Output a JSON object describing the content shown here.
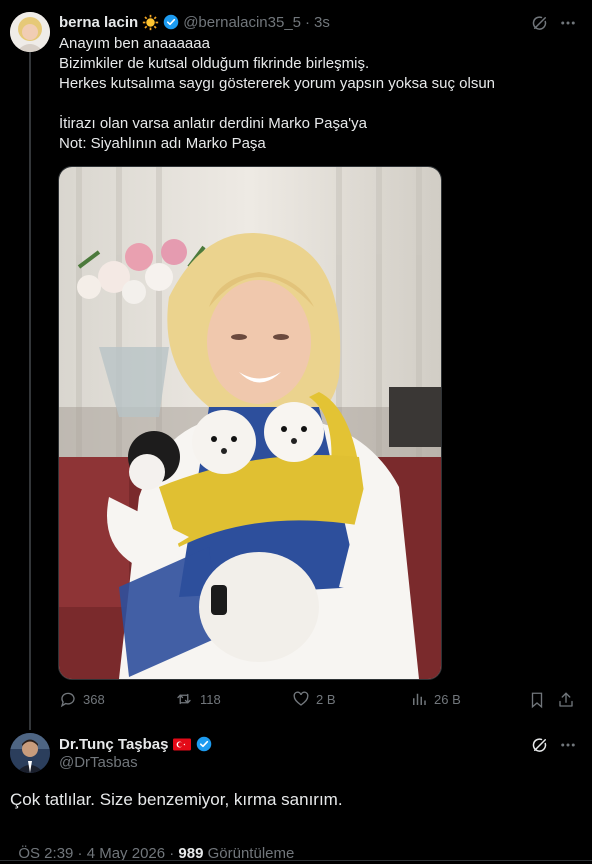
{
  "tweet1": {
    "display_name": "berna lacin",
    "handle": "@bernalacin35_5",
    "separator": "·",
    "time": "3s",
    "text": "Anayım ben anaaaaaa\nBizimkiler de kutsal olduğum fikrinde birleşmiş.\nHerkes kutsalıma saygı göstererek yorum yapsın yoksa suç olsun\n\nİtirazı olan varsa anlatır derdini Marko Paşa'ya\nNot: Siyahlının adı Marko Paşa",
    "stats": {
      "replies": "368",
      "retweets": "118",
      "likes": "2 B",
      "views": "26 B"
    }
  },
  "tweet2": {
    "display_name": "Dr.Tunç Taşbaş",
    "handle": "@DrTasbas",
    "text": "Çok tatlılar. Size benzemiyor, kırma sanırım.",
    "time_line": "ÖS 2:39 · 4 May 2026 · ",
    "views_count": "989",
    "views_label": " Görüntüleme"
  },
  "colors": {
    "background": "#000000",
    "text": "#e7e9ea",
    "muted": "#71767b",
    "verified": "#1d9bf0"
  },
  "icons": [
    "grok-icon",
    "more-icon",
    "reply-icon",
    "retweet-icon",
    "like-icon",
    "views-icon",
    "bookmark-icon",
    "share-icon",
    "verified-badge-icon",
    "sun-emoji-icon",
    "turkey-flag-icon"
  ]
}
